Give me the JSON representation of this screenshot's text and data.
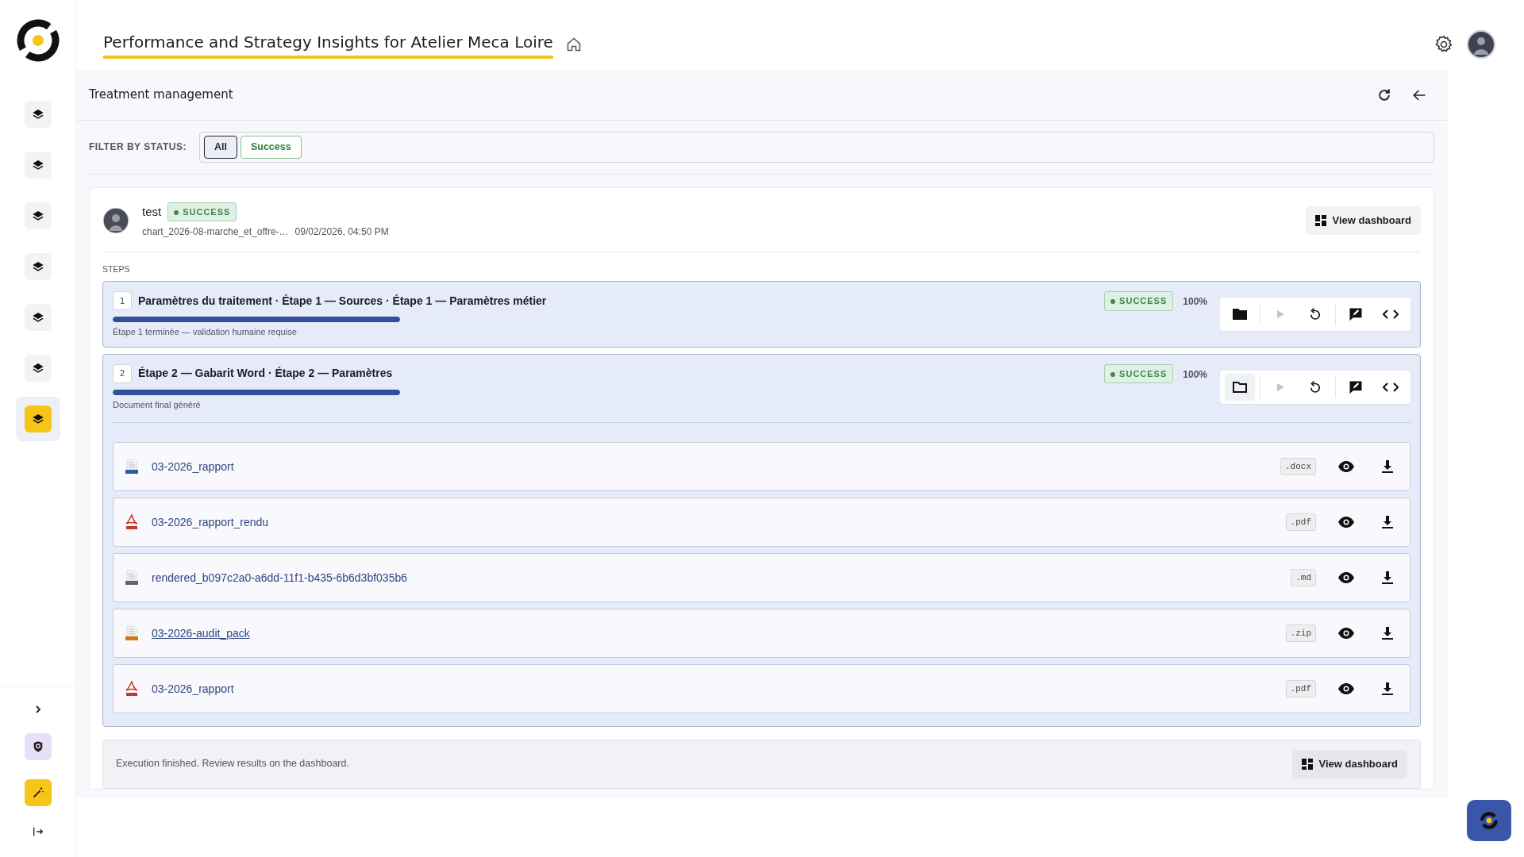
{
  "app": {
    "title": "Performance and Strategy Insights for Atelier Meca Loire"
  },
  "sidebar": {
    "items": [
      {
        "selected": false
      },
      {
        "selected": false
      },
      {
        "selected": false
      },
      {
        "selected": false
      },
      {
        "selected": false
      },
      {
        "selected": false
      },
      {
        "selected": true
      }
    ]
  },
  "panel": {
    "title": "Treatment management"
  },
  "filter": {
    "label": "FILTER BY STATUS:",
    "options": [
      {
        "label": "All",
        "selected": true
      },
      {
        "label": "Success",
        "selected": false
      }
    ]
  },
  "run": {
    "name": "test",
    "status": "SUCCESS",
    "file": "chart_2026-08-marche_et_offre-…",
    "date": "09/02/2026, 04:50 PM",
    "action": "View dashboard"
  },
  "steps_label": "STEPS",
  "steps": [
    {
      "number": "1",
      "title": "Paramètres du traitement · Étape 1 — Sources · Étape 1 — Paramètres métier",
      "status": "SUCCESS",
      "percent": "100%",
      "level": 1,
      "note": "Étape 1 terminée — validation humaine requise",
      "expanded": false
    },
    {
      "number": "2",
      "title": "Étape 2 — Gabarit Word · Étape 2 — Paramètres",
      "status": "SUCCESS",
      "percent": "100%",
      "level": 1,
      "note": "Document final généré",
      "expanded": true
    }
  ],
  "files": [
    {
      "name": "03-2026_rapport",
      "ext": ".docx",
      "kind": "docx",
      "hovered": false
    },
    {
      "name": "03-2026_rapport_rendu",
      "ext": ".pdf",
      "kind": "pdf",
      "hovered": false
    },
    {
      "name": "rendered_b097c2a0-a6dd-11f1-b435-6b6d3bf035b6",
      "ext": ".md",
      "kind": "md",
      "hovered": false
    },
    {
      "name": "03-2026-audit_pack",
      "ext": ".zip",
      "kind": "zip",
      "hovered": true
    },
    {
      "name": "03-2026_rapport",
      "ext": ".pdf",
      "kind": "pdf",
      "hovered": false
    }
  ],
  "footer": {
    "message": "Execution finished. Review results on the dashboard.",
    "action": "View dashboard"
  }
}
